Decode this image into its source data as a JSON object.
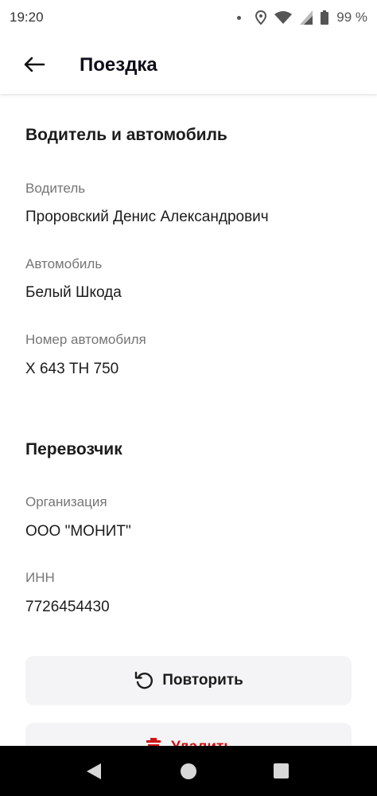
{
  "status_bar": {
    "time": "19:20",
    "battery_percent": "99 %",
    "icons": [
      "notification-dot-icon",
      "location-icon",
      "wifi-icon",
      "signal-icon",
      "battery-icon"
    ]
  },
  "header": {
    "title": "Поездка",
    "back_icon": "arrow-left-icon"
  },
  "driver_section": {
    "title": "Водитель и автомобиль",
    "fields": [
      {
        "label": "Водитель",
        "value": "Проровский Денис Александрович"
      },
      {
        "label": "Автомобиль",
        "value": "Белый Шкода"
      },
      {
        "label": "Номер автомобиля",
        "value": "Х 643 ТН 750"
      }
    ]
  },
  "carrier_section": {
    "title": "Перевозчик",
    "fields": [
      {
        "label": "Организация",
        "value": "ООО \"МОНИТ\""
      },
      {
        "label": "ИНН",
        "value": "7726454430"
      }
    ]
  },
  "actions": {
    "repeat": {
      "label": "Повторить",
      "icon": "refresh-icon"
    },
    "delete": {
      "label": "Удалить",
      "icon": "trash-icon",
      "color": "#d01414"
    }
  },
  "colors": {
    "button_bg": "#f4f4f6",
    "label_gray": "#757575",
    "danger": "#d01414"
  }
}
